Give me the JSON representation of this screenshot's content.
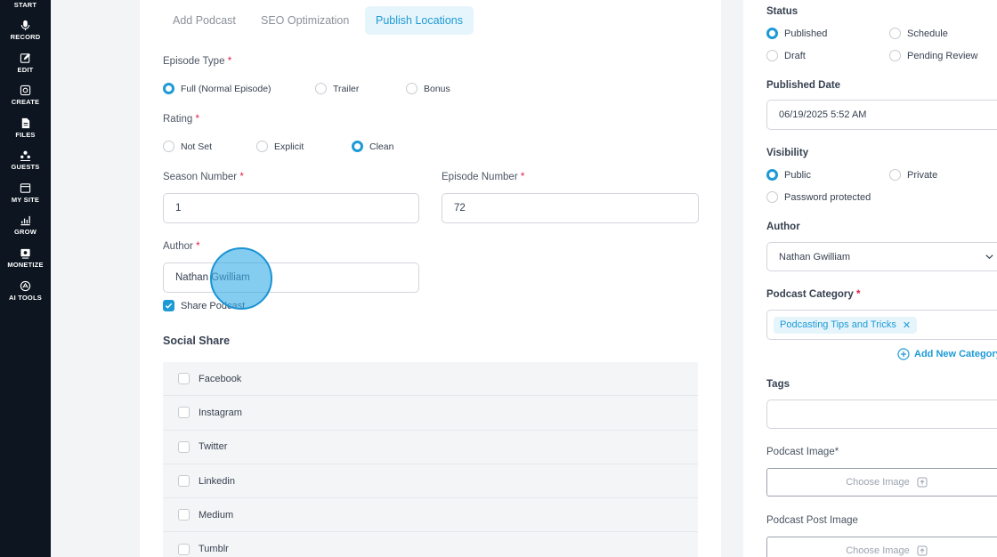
{
  "sidebar": {
    "items": [
      {
        "label": "START",
        "icon": "start-icon"
      },
      {
        "label": "RECORD",
        "icon": "microphone-icon"
      },
      {
        "label": "EDIT",
        "icon": "edit-icon"
      },
      {
        "label": "CREATE",
        "icon": "create-icon"
      },
      {
        "label": "FILES",
        "icon": "files-icon"
      },
      {
        "label": "GUESTS",
        "icon": "guests-icon"
      },
      {
        "label": "MY SITE",
        "icon": "site-icon"
      },
      {
        "label": "GROW",
        "icon": "chart-icon"
      },
      {
        "label": "MONETIZE",
        "icon": "monetize-icon"
      },
      {
        "label": "AI TOOLS",
        "icon": "ai-icon"
      }
    ]
  },
  "tabs": [
    {
      "label": "Add Podcast",
      "active": false
    },
    {
      "label": "SEO Optimization",
      "active": false
    },
    {
      "label": "Publish Locations",
      "active": true
    }
  ],
  "form": {
    "episode_type": {
      "label": "Episode Type",
      "options": [
        "Full (Normal Episode)",
        "Trailer",
        "Bonus"
      ],
      "selected": "Full (Normal Episode)"
    },
    "rating": {
      "label": "Rating",
      "options": [
        "Not Set",
        "Explicit",
        "Clean"
      ],
      "selected": "Clean"
    },
    "season_number": {
      "label": "Season Number",
      "value": "1"
    },
    "episode_number": {
      "label": "Episode Number",
      "value": "72"
    },
    "author": {
      "label": "Author",
      "value": "Nathan Gwilliam"
    },
    "share_podcast": {
      "label": "Share Podcast",
      "checked": true
    },
    "required_mark": "*"
  },
  "social_share": {
    "title": "Social Share",
    "items": [
      "Facebook",
      "Instagram",
      "Twitter",
      "Linkedin",
      "Medium",
      "Tumblr"
    ]
  },
  "right": {
    "status": {
      "label": "Status",
      "options": [
        "Published",
        "Schedule",
        "Draft",
        "Pending Review"
      ],
      "selected": "Published"
    },
    "published_date": {
      "label": "Published Date",
      "value": "06/19/2025 5:52 AM"
    },
    "visibility": {
      "label": "Visibility",
      "options": [
        "Public",
        "Private",
        "Password protected"
      ],
      "selected": "Public"
    },
    "author": {
      "label": "Author",
      "value": "Nathan Gwilliam"
    },
    "category": {
      "label": "Podcast Category",
      "chip": "Podcasting Tips and Tricks",
      "add_new": "Add New Category"
    },
    "tags": {
      "label": "Tags",
      "value": ""
    },
    "podcast_image": {
      "label": "Podcast Image*",
      "button": "Choose Image"
    },
    "podcast_post_image": {
      "label": "Podcast Post Image",
      "button": "Choose Image"
    }
  },
  "colors": {
    "accent": "#1c9ad6",
    "sidebar": "#0c1520",
    "required": "#e11d48"
  }
}
